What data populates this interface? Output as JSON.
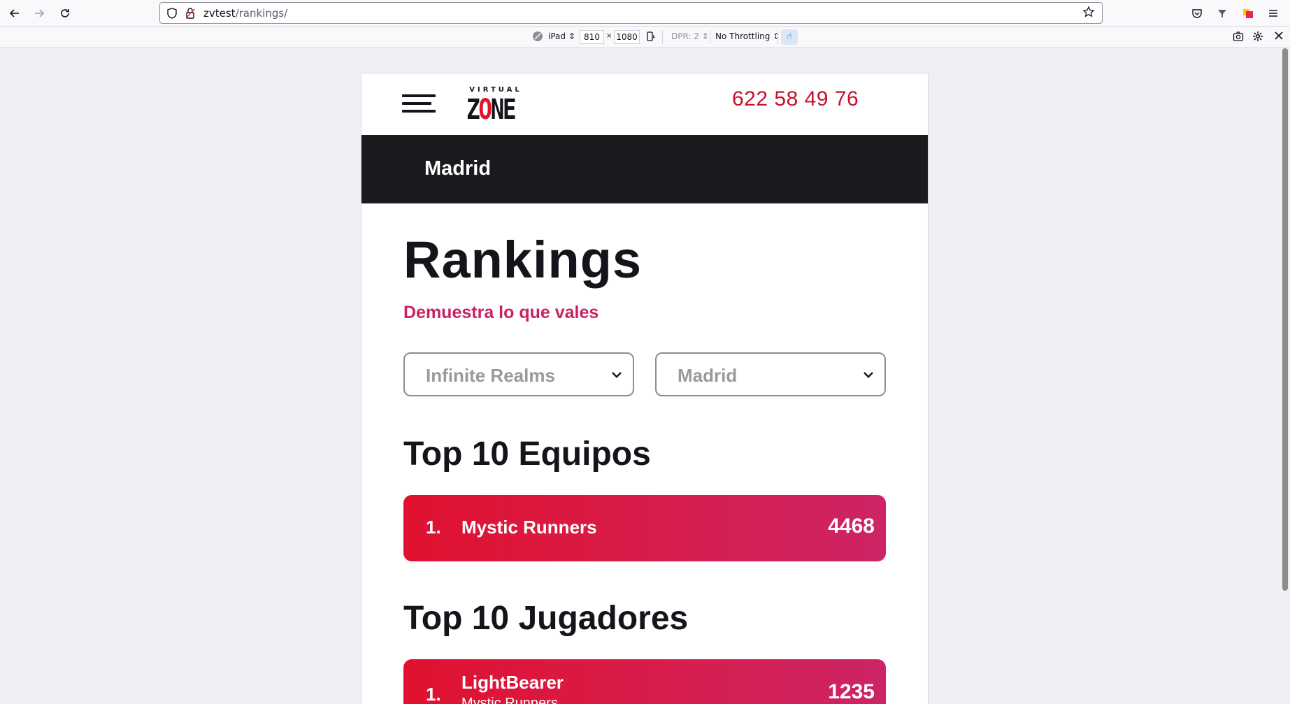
{
  "browser": {
    "url_host": "zvtest",
    "url_path": "/rankings/"
  },
  "rdm": {
    "device": "iPad",
    "width": "810",
    "times": "×",
    "height": "1080",
    "dpr": "DPR: 2",
    "throttling": "No Throttling"
  },
  "site": {
    "logo_top": "VIRTUAL",
    "logo_z": "Z",
    "logo_o": "O",
    "logo_ne": "NE",
    "phone": "622 58 49 76",
    "city": "Madrid"
  },
  "page": {
    "title": "Rankings",
    "subtitle": "Demuestra lo que vales"
  },
  "filters": {
    "game": "Infinite Realms",
    "location": "Madrid"
  },
  "teams": {
    "title": "Top 10 Equipos",
    "items": [
      {
        "rank": "1.",
        "name": "Mystic Runners",
        "score": "4468"
      }
    ]
  },
  "players": {
    "title": "Top 10 Jugadores",
    "items": [
      {
        "rank": "1.",
        "name": "LightBearer",
        "team": "Mystic Runners",
        "score": "1235"
      }
    ]
  },
  "colors": {
    "brand_red": "#c8102e",
    "accent_pink": "#cc2062",
    "dark_bar": "#1b1a1e"
  }
}
